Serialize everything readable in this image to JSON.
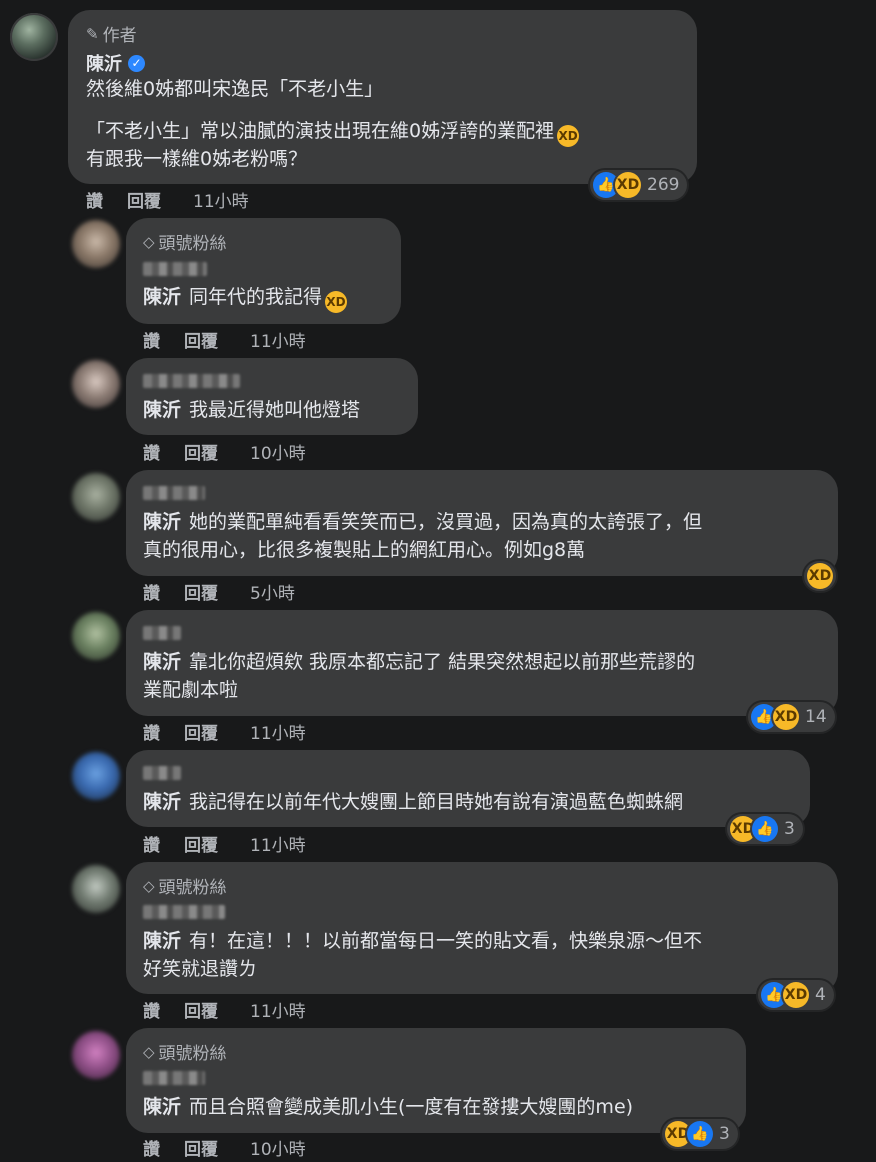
{
  "post_author": {
    "badge": "作者",
    "name": "陳沂",
    "lines": [
      "然後維0姊都叫宋逸民「不老小生」",
      "「不老小生」常以油膩的演技出現在維0姊浮誇的業配裡",
      "有跟我一樣維0姊老粉嗎？"
    ],
    "reaction_count": "269",
    "actions": {
      "like": "讚",
      "reply": "回覆",
      "time": "11小時"
    }
  },
  "replies": [
    {
      "badge": "頭號粉絲",
      "mention": "陳沂",
      "lines": [
        "同年代的我記得"
      ],
      "actions": {
        "like": "讚",
        "reply": "回覆",
        "time": "11小時"
      }
    },
    {
      "mention": "陳沂",
      "lines": [
        "我最近得她叫他燈塔"
      ],
      "actions": {
        "like": "讚",
        "reply": "回覆",
        "time": "10小時"
      }
    },
    {
      "mention": "陳沂",
      "lines": [
        "她的業配單純看看笑笑而已，沒買過，因為真的太誇張了，但",
        "真的很用心，比很多複製貼上的網紅用心。例如g8萬"
      ],
      "actions": {
        "like": "讚",
        "reply": "回覆",
        "time": "5小時"
      }
    },
    {
      "mention": "陳沂",
      "lines": [
        "靠北你超煩欸 我原本都忘記了 結果突然想起以前那些荒謬的",
        "業配劇本啦"
      ],
      "reaction_count": "14",
      "actions": {
        "like": "讚",
        "reply": "回覆",
        "time": "11小時"
      }
    },
    {
      "mention": "陳沂",
      "lines": [
        "我記得在以前年代大嫂團上節目時她有說有演過藍色蜘蛛網"
      ],
      "reaction_count": "3",
      "actions": {
        "like": "讚",
        "reply": "回覆",
        "time": "11小時"
      }
    },
    {
      "badge": "頭號粉絲",
      "mention": "陳沂",
      "lines": [
        "有！在這！！！以前都當每日一笑的貼文看，快樂泉源～但不",
        "好笑就退讚ㄌ"
      ],
      "reaction_count": "4",
      "actions": {
        "like": "讚",
        "reply": "回覆",
        "time": "11小時"
      }
    },
    {
      "badge": "頭號粉絲",
      "mention": "陳沂",
      "lines": [
        "而且合照會變成美肌小生(一度有在發摟大嫂團的me)"
      ],
      "reaction_count": "3",
      "actions": {
        "like": "讚",
        "reply": "回覆",
        "time": "10小時"
      }
    }
  ],
  "colors": {
    "background": "#18191a",
    "bubble": "#3a3b3c",
    "text": "#e4e6eb",
    "secondary_text": "#b0b3b8",
    "like_blue": "#1877f2",
    "haha_yellow": "#f7b928"
  },
  "icons": {
    "author_badge": "pencil-icon",
    "fan_badge": "diamond-icon",
    "verified": "verified-check-icon",
    "like": "thumbs-up-icon",
    "haha": "laughing-face-icon"
  }
}
